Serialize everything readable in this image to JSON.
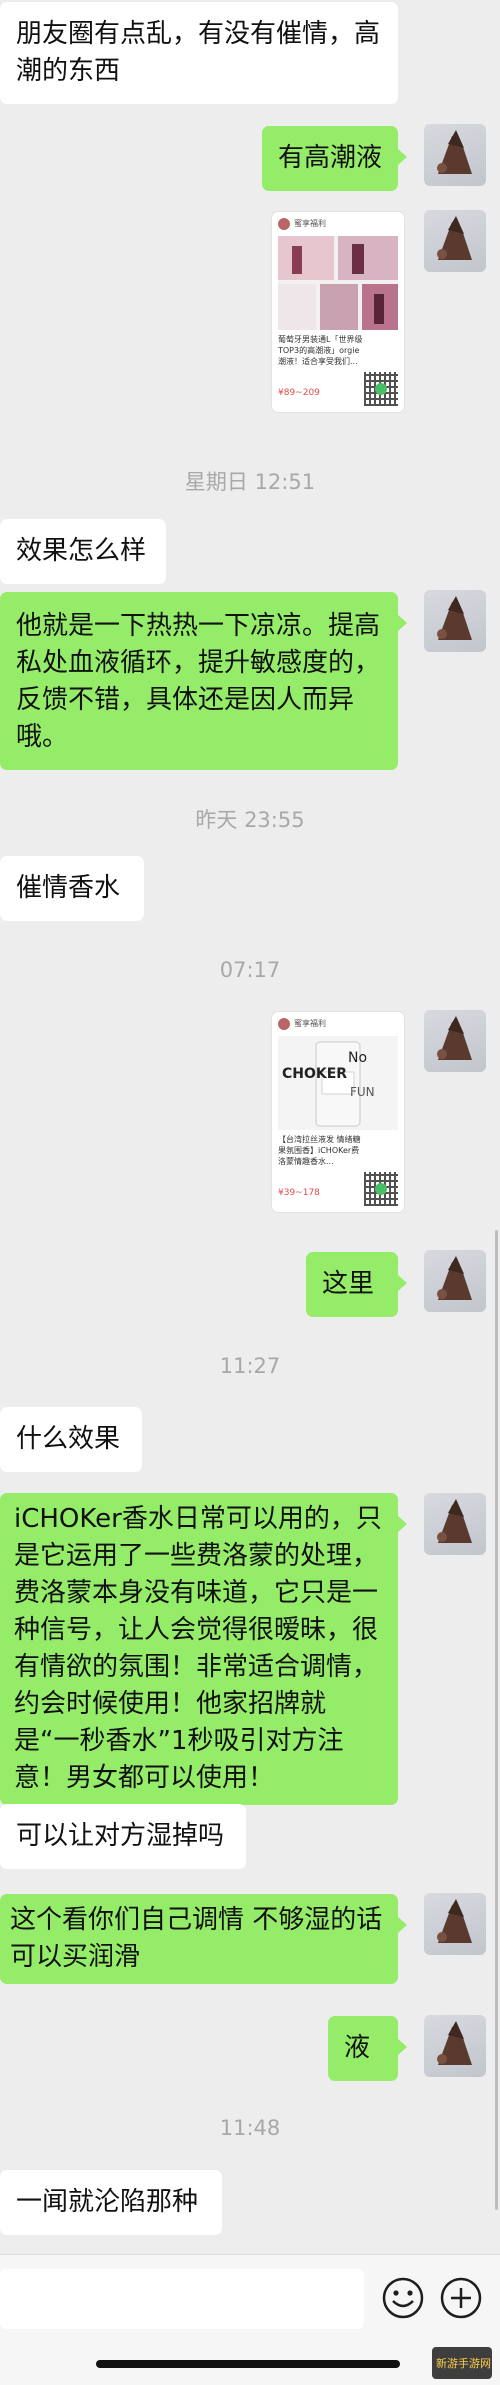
{
  "messages": [
    {
      "text": "朋友圈有点乱，有没有催情，高潮的东西"
    },
    {
      "text": "有高潮液"
    },
    {
      "text": "效果怎么样"
    },
    {
      "text": "他就是一下热热一下凉凉。提高私处血液循环，提升敏感度的，反馈不错，具体还是因人而异哦。"
    },
    {
      "text": "催情香水"
    },
    {
      "text": "这里"
    },
    {
      "text": "什么效果"
    },
    {
      "text": "iCHOKer香水日常可以用的，只是它运用了一些费洛蒙的处理，费洛蒙本身没有味道，它只是一种信号，让人会觉得很暧昧，很有情欲的氛围！非常适合调情，约会时候使用！他家招牌就是“一秒香水”1秒吸引对方注意！男女都可以使用！"
    },
    {
      "text": "可以让对方湿掉吗"
    },
    {
      "text": "这个看你们自己调情 不够湿的话可以买润滑"
    },
    {
      "text": "液"
    },
    {
      "text": "一闻就沦陷那种"
    }
  ],
  "timestamps": [
    "星期日 12:51",
    "昨天 23:55",
    "07:17",
    "11:27",
    "11:48"
  ],
  "cards": [
    {
      "shop": "蜜享福利",
      "desc": "葡萄牙男装通L「世界级TOP3的高潮液」orgie潮液！适合享受我们...",
      "price": "¥89~209"
    },
    {
      "shop": "蜜享福利",
      "desc": "【台湾拉丝液发 情绪糖果氛围香】iCHOKer费洛蒙情趣香水...",
      "price": "¥39~178",
      "logo_text": "CHOKER"
    }
  ],
  "input": {
    "placeholder": "",
    "emoji_icon": "smiley-icon",
    "add_icon": "plus-circle-icon"
  },
  "watermark": {
    "text": "新游手游网"
  },
  "colors": {
    "background": "#ededed",
    "incoming": "#ffffff",
    "outgoing": "#95ec69",
    "timestamp": "#a8a8a8"
  }
}
